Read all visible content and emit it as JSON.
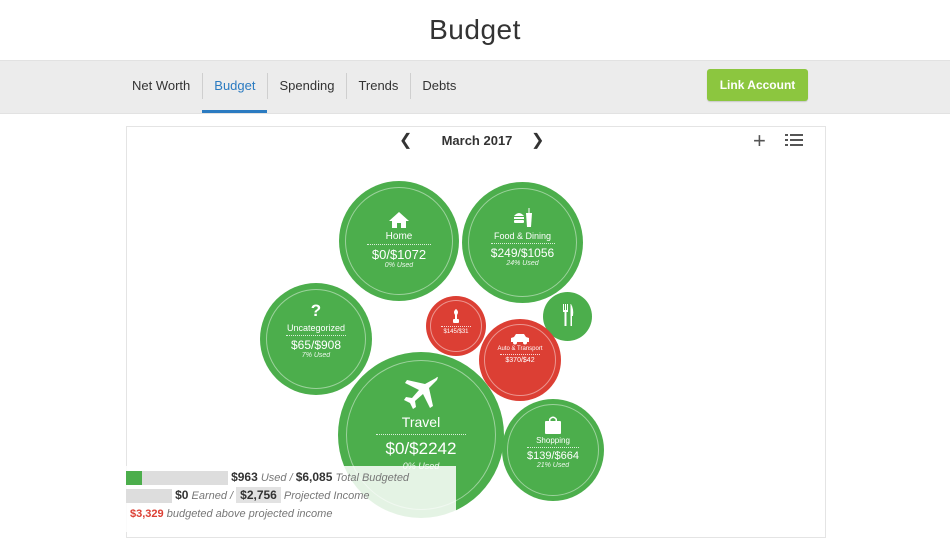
{
  "page": {
    "title": "Budget"
  },
  "nav": {
    "tabs": [
      {
        "label": "Net Worth"
      },
      {
        "label": "Budget"
      },
      {
        "label": "Spending"
      },
      {
        "label": "Trends"
      },
      {
        "label": "Debts"
      }
    ],
    "active_tab": "Budget",
    "link_account_label": "Link Account"
  },
  "colors": {
    "accent": "#8cc63f",
    "under_budget": "#4cae4c",
    "over_budget": "#dc3f34",
    "active_tab": "#2b7bc1"
  },
  "panel": {
    "month": "March 2017",
    "prev_icon": "chevron-left-icon",
    "next_icon": "chevron-right-icon",
    "add_icon": "plus-icon",
    "list_icon": "list-icon"
  },
  "bubbles": {
    "home": {
      "name": "Home",
      "amount": "$0/$1072",
      "used": "0% Used",
      "icon": "house-icon",
      "status": "under"
    },
    "food": {
      "name": "Food & Dining",
      "amount": "$249/$1056",
      "used": "24% Used",
      "icon": "fast-food-icon",
      "status": "under"
    },
    "uncategorized": {
      "name": "Uncategorized",
      "amount": "$65/$908",
      "used": "7% Used",
      "icon": "question-mark-icon",
      "status": "under"
    },
    "small_red": {
      "amount": "$145/$31",
      "icon": "plant-icon",
      "status": "over"
    },
    "utensils": {
      "icon": "utensils-icon",
      "status": "under"
    },
    "auto": {
      "name": "Auto & Transport",
      "amount": "$370/$42",
      "icon": "car-icon",
      "status": "over"
    },
    "travel": {
      "name": "Travel",
      "amount": "$0/$2242",
      "used": "0% Used",
      "icon": "airplane-icon",
      "status": "under"
    },
    "shopping": {
      "name": "Shopping",
      "amount": "$139/$664",
      "used": "21% Used",
      "icon": "shopping-bag-icon",
      "status": "under"
    }
  },
  "summary": {
    "used": "$963",
    "used_label": "Used /",
    "total_budgeted": "$6,085",
    "total_budgeted_label": "Total Budgeted",
    "used_fraction": 0.16,
    "earned": "$0",
    "earned_label": "Earned /",
    "projected_income": "$2,756",
    "projected_income_label": "Projected Income",
    "earned_fraction": 0.0,
    "over_amount": "$3,329",
    "over_label": "budgeted above projected income"
  }
}
